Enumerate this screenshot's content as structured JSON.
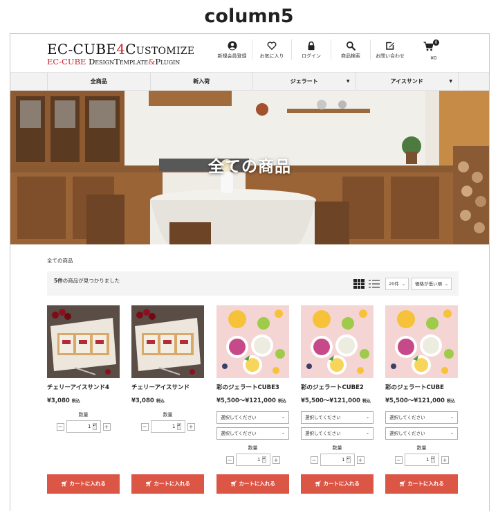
{
  "caption": "column5",
  "logo": {
    "main_prefix": "EC-CUBE",
    "main_number": "4",
    "main_suffix": "Customize",
    "sub_red": "EC-CUBE ",
    "sub_black": "DesignTemplate",
    "sub_amp": "&",
    "sub_black2": "Plugin"
  },
  "header_nav": [
    {
      "label": "新規会員登録",
      "icon": "user-icon"
    },
    {
      "label": "お気に入り",
      "icon": "heart-icon"
    },
    {
      "label": "ログイン",
      "icon": "lock-icon"
    },
    {
      "label": "商品検索",
      "icon": "search-icon"
    },
    {
      "label": "お問い合わせ",
      "icon": "edit-icon"
    }
  ],
  "cart": {
    "count": "0",
    "total": "¥0"
  },
  "global_nav": [
    {
      "label": "全商品"
    },
    {
      "label": "新入荷"
    },
    {
      "label": "ジェラート"
    },
    {
      "label": "アイスサンド"
    }
  ],
  "hero": {
    "title": "全ての商品"
  },
  "breadcrumb": "全ての商品",
  "toolbar": {
    "result_count": "5件",
    "result_text": "の商品が見つかりました",
    "per_page": "20件",
    "sort": "価格が低い順"
  },
  "products": [
    {
      "name": "チェリーアイスサンド4",
      "price": "¥3,080",
      "tax": "税込",
      "qty_label": "数量",
      "qty": "1",
      "cart_label": "カートに入れる",
      "selects": [],
      "image": "ice-sandwich"
    },
    {
      "name": "チェリーアイスサンド",
      "price": "¥3,080",
      "tax": "税込",
      "qty_label": "数量",
      "qty": "1",
      "cart_label": "カートに入れる",
      "selects": [],
      "image": "ice-sandwich"
    },
    {
      "name": "彩のジェラートCUBE3",
      "price": "¥5,500～¥121,000",
      "tax": "税込",
      "qty_label": "数量",
      "qty": "1",
      "cart_label": "カートに入れる",
      "selects": [
        "選択してください",
        "選択してください"
      ],
      "image": "gelato"
    },
    {
      "name": "彩のジェラートCUBE2",
      "price": "¥5,500～¥121,000",
      "tax": "税込",
      "qty_label": "数量",
      "qty": "1",
      "cart_label": "カートに入れる",
      "selects": [
        "選択してください",
        "選択してください"
      ],
      "image": "gelato"
    },
    {
      "name": "彩のジェラートCUBE",
      "price": "¥5,500～¥121,000",
      "tax": "税込",
      "qty_label": "数量",
      "qty": "1",
      "cart_label": "カートに入れる",
      "selects": [
        "選択してください",
        "選択してください"
      ],
      "image": "gelato"
    }
  ],
  "colors": {
    "accent": "#dc5646",
    "logo_red": "#c8242d"
  }
}
